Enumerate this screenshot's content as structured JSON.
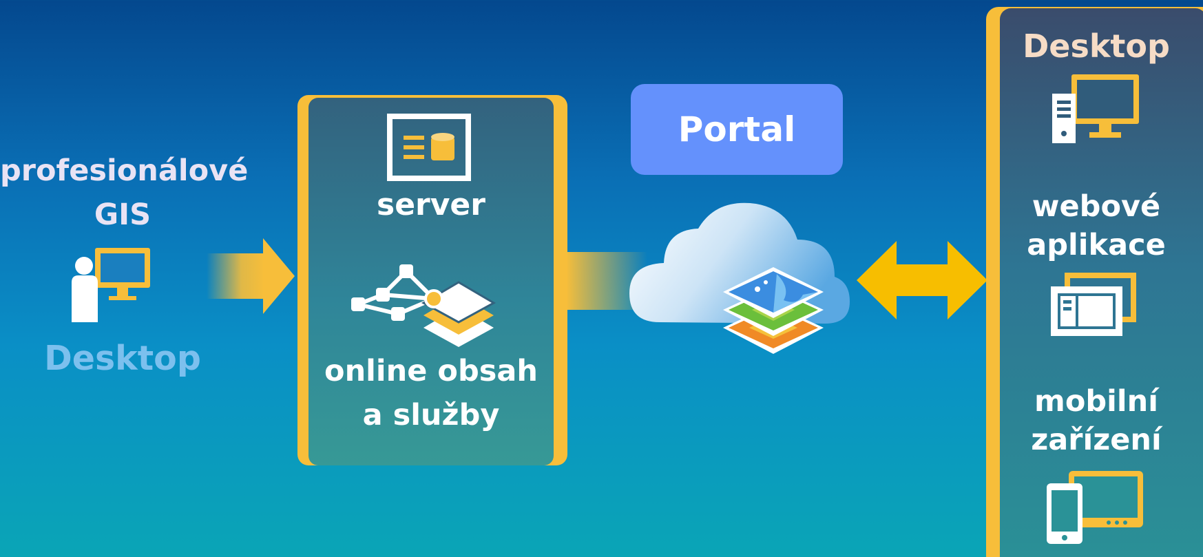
{
  "left": {
    "title_line1": "profesionálové",
    "title_line2": "GIS",
    "subtitle": "Desktop",
    "icon": "person-at-desktop-icon"
  },
  "server_panel": {
    "server_label": "server",
    "content_line1": "online obsah",
    "content_line2": "a služby",
    "icons": [
      "server-icon",
      "network-layers-icon"
    ]
  },
  "portal": {
    "label": "Portal",
    "icons": [
      "cloud-icon",
      "map-layers-icon"
    ]
  },
  "clients": {
    "desktop": "Desktop",
    "web_line1": "webové",
    "web_line2": "aplikace",
    "mobile_line1": "mobilní",
    "mobile_line2": "zařízení",
    "icons": [
      "desktop-computer-icon",
      "web-app-icon",
      "mobile-devices-icon"
    ]
  },
  "colors": {
    "accent": "#f7be3a",
    "portal_box": "#6491fc",
    "background_top": "#04488e",
    "background_bottom": "#0aa5b6"
  }
}
